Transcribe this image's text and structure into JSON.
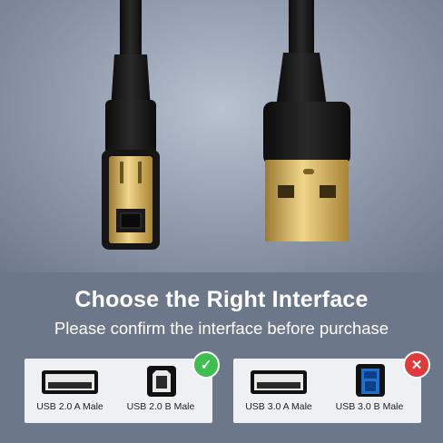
{
  "headline": "Choose the Right Interface",
  "subline": "Please confirm the interface before purchase",
  "compatible": {
    "items": [
      {
        "label": "USB 2.0 A Male",
        "icon": "usb-a-port-icon"
      },
      {
        "label": "USB 2.0 B Male",
        "icon": "usb-b-port-icon"
      }
    ],
    "badge": "✓",
    "badge_color": "#3fbf4f"
  },
  "incompatible": {
    "items": [
      {
        "label": "USB 3.0 A Male",
        "icon": "usb-a-port-icon"
      },
      {
        "label": "USB 3.0 B Male",
        "icon": "usb3-b-port-icon"
      }
    ],
    "badge": "✕",
    "badge_color": "#e03a3a"
  },
  "colors": {
    "band": "#6d778a",
    "card": "#eef0f4",
    "usb3_blue": "#1f6fd1",
    "gold": "#c9a24a"
  }
}
